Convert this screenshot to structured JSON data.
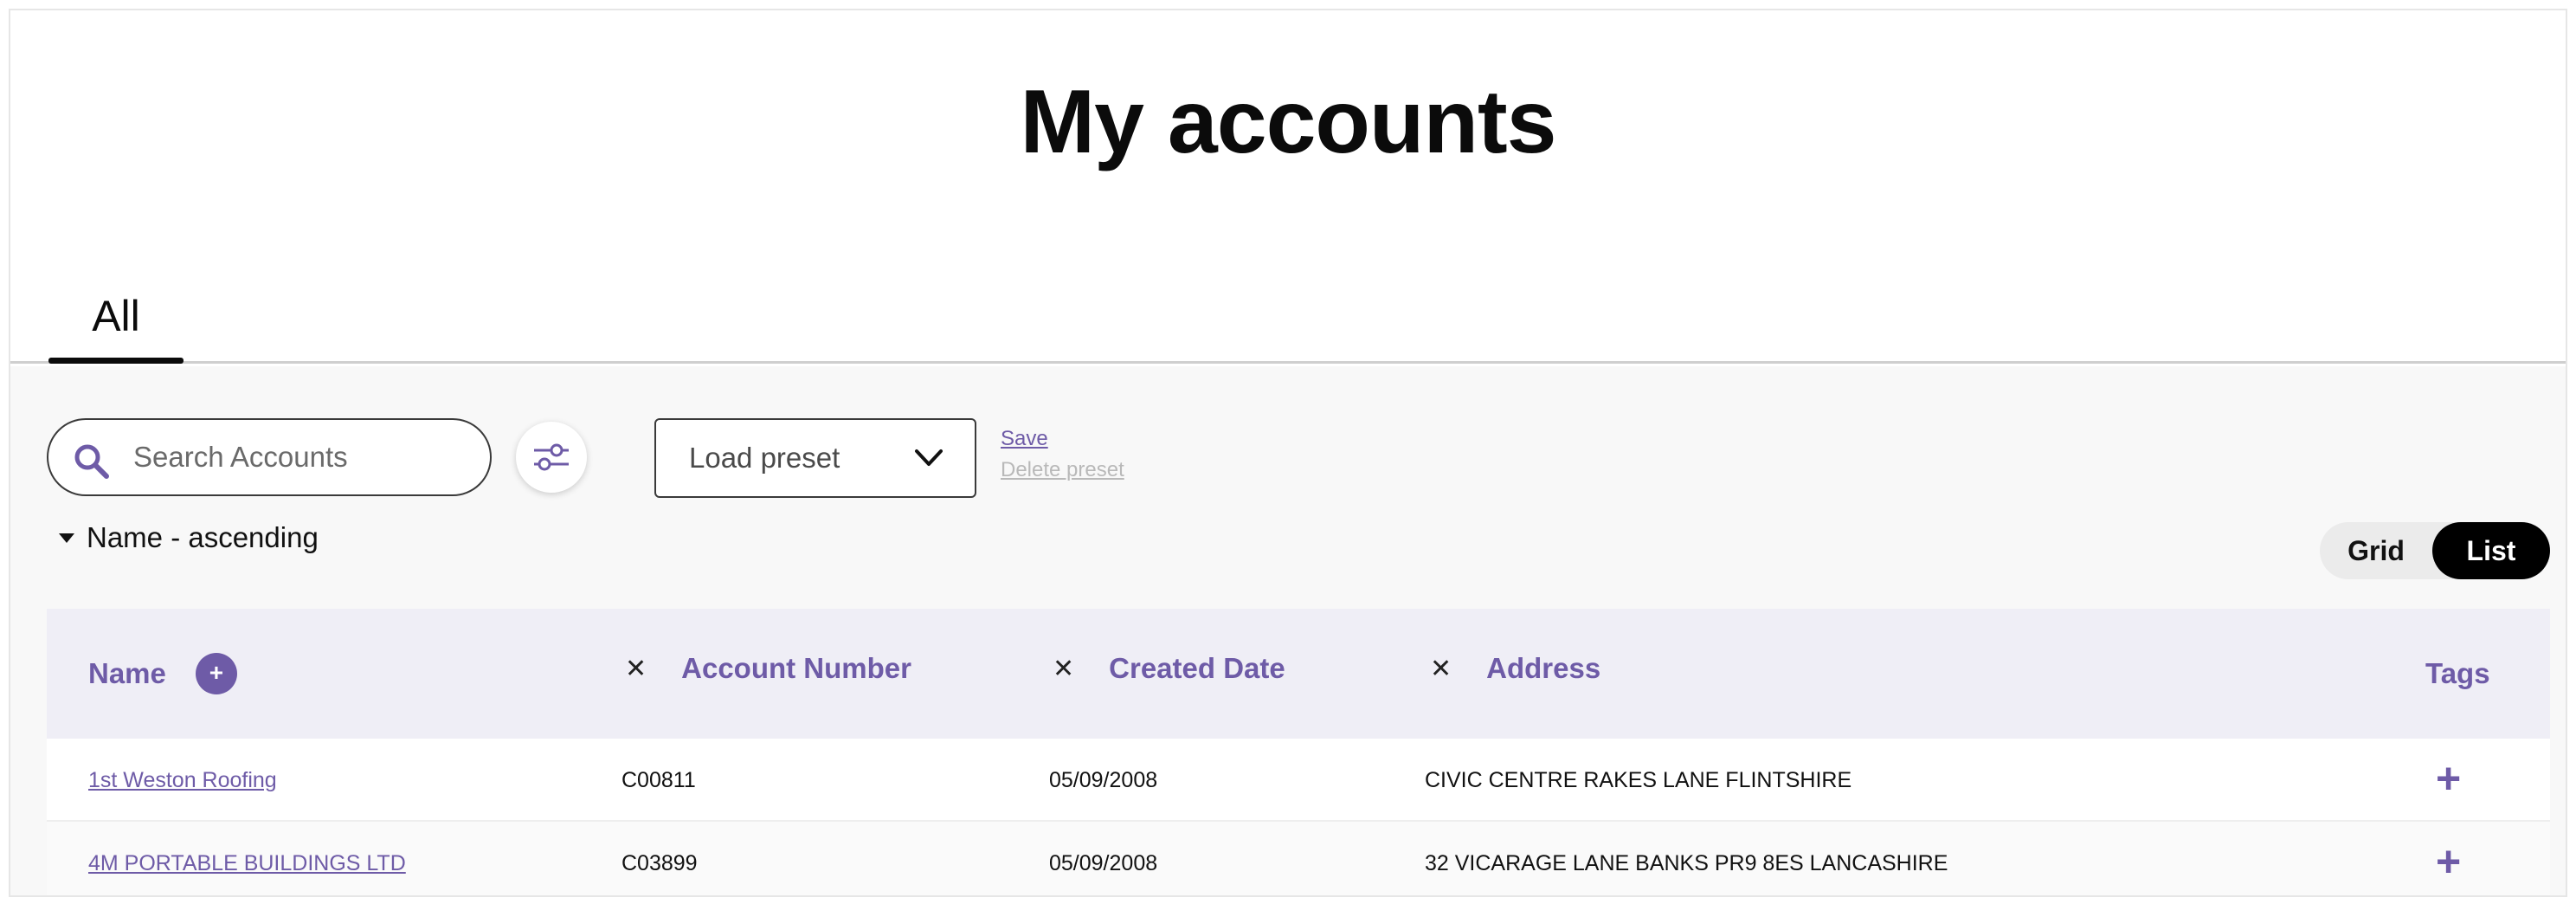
{
  "page": {
    "title": "My accounts"
  },
  "tabs": [
    {
      "label": "All",
      "active": true
    }
  ],
  "toolbar": {
    "search_placeholder": "Search Accounts",
    "preset_label": "Load preset",
    "save_label": "Save",
    "delete_label": "Delete preset",
    "sort_label": "Name - ascending"
  },
  "view_toggle": {
    "grid_label": "Grid",
    "list_label": "List",
    "selected": "List"
  },
  "table": {
    "columns": [
      {
        "label": "Name"
      },
      {
        "label": "Account Number",
        "close_glyph": "✕"
      },
      {
        "label": "Created Date",
        "close_glyph": "✕"
      },
      {
        "label": "Address",
        "close_glyph": "✕"
      },
      {
        "label": "Tags"
      }
    ],
    "add_column_glyph": "+",
    "add_tag_glyph": "+",
    "rows": [
      {
        "name": "1st Weston Roofing",
        "account_number": "C00811",
        "created_date": "05/09/2008",
        "address": "CIVIC CENTRE RAKES LANE FLINTSHIRE"
      },
      {
        "name": "4M PORTABLE BUILDINGS LTD",
        "account_number": "C03899",
        "created_date": "05/09/2008",
        "address": "32 VICARAGE LANE BANKS PR9 8ES LANCASHIRE"
      }
    ]
  },
  "colors": {
    "accent": "#6e5ba7",
    "header_bg": "#efeef6",
    "content_bg": "#f8f8f8"
  },
  "icons": {
    "search": "search-icon",
    "filter": "sliders-icon",
    "dropdown": "chevron-down-icon",
    "sort": "caret-down-icon"
  }
}
